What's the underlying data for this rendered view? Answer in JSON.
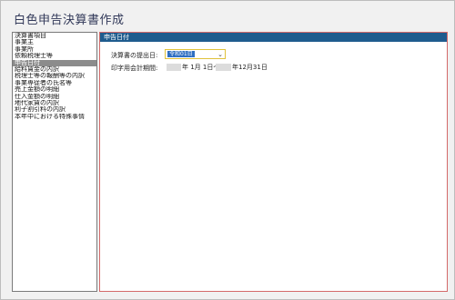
{
  "app": {
    "title": "白色申告決算書作成"
  },
  "sidebar": {
    "items": [
      {
        "label": "決算書項目",
        "selected": false
      },
      {
        "label": "事業主",
        "selected": false
      },
      {
        "label": "事業所",
        "selected": false
      },
      {
        "label": "依頼税理士等",
        "selected": false
      },
      {
        "label": "申告日付",
        "selected": true
      },
      {
        "label": "給料賃金の内訳",
        "selected": false
      },
      {
        "label": "税理士等の報酬等の内訳",
        "selected": false
      },
      {
        "label": "事業専従者の氏名等",
        "selected": false
      },
      {
        "label": "売上金額の明細",
        "selected": false
      },
      {
        "label": "仕入金額の明細",
        "selected": false
      },
      {
        "label": "地代家賃の内訳",
        "selected": false
      },
      {
        "label": "利子割引料の内訳",
        "selected": false
      },
      {
        "label": "本年中における特殊事情",
        "selected": false
      }
    ]
  },
  "panel": {
    "header": "申告日付",
    "submit_date_label": "決算書の提出日:",
    "submit_date_value": "令和01日",
    "print_period_label": "印字用会計期間:",
    "period_start_suffix": "年 1月 1日～",
    "period_end_suffix": "年12月31日"
  },
  "colors": {
    "header_bg": "#1f5c8e",
    "selected_bg": "#8c8c8c",
    "panel_border": "#d46a6a",
    "dropdown_border": "#e0c23b"
  },
  "icons": {
    "dropdown": "chevron-down-icon"
  }
}
